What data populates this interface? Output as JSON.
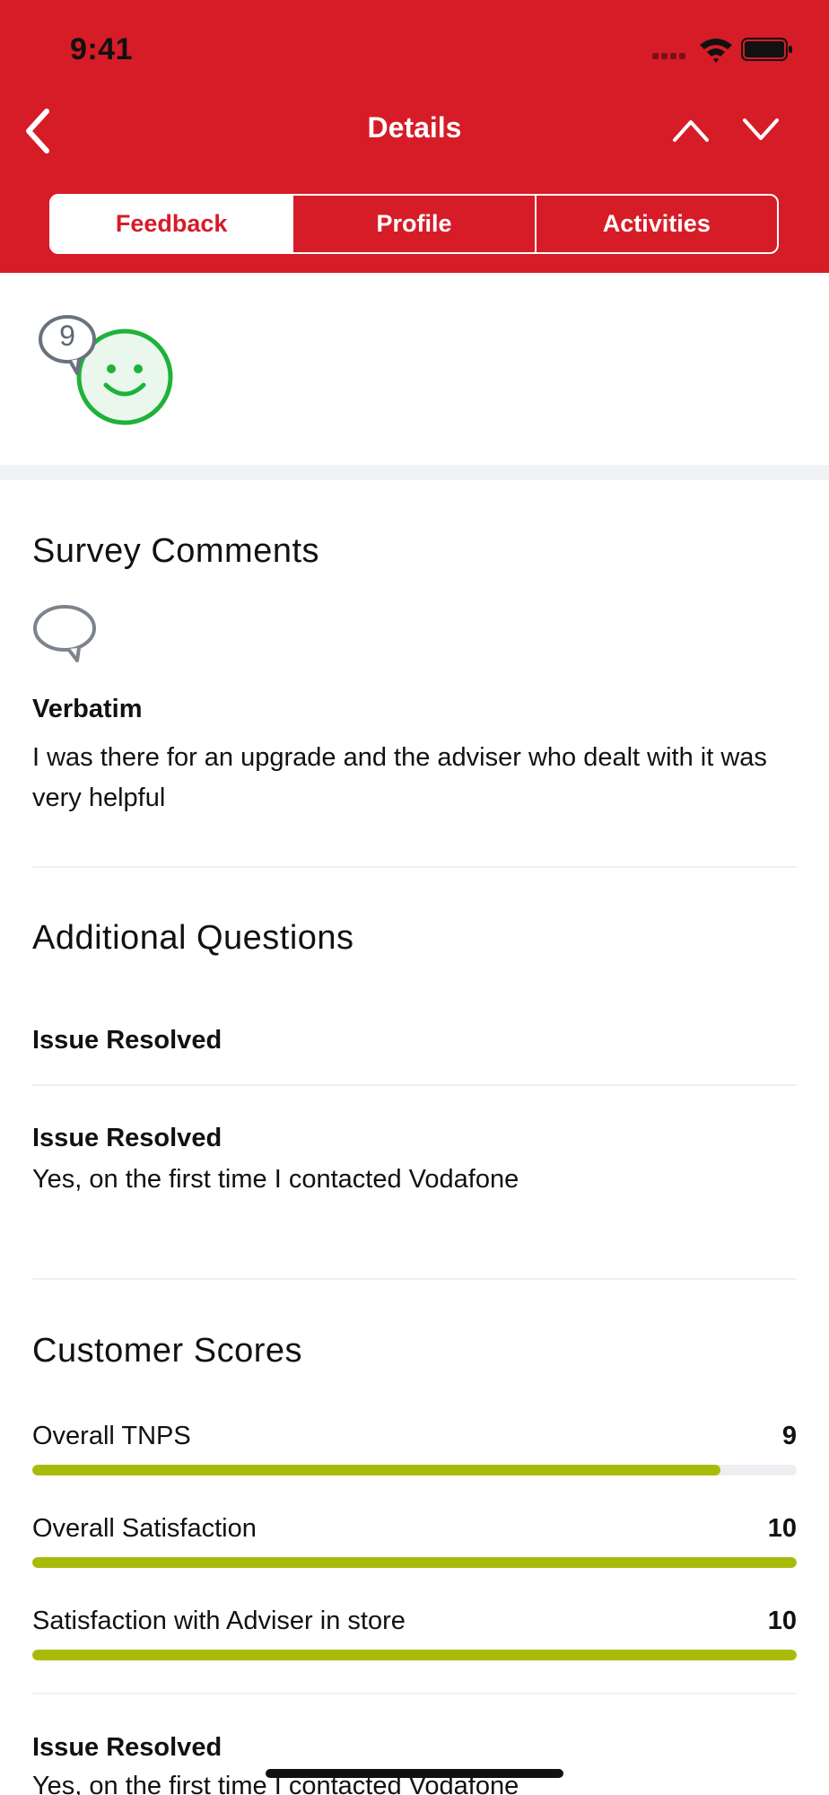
{
  "status_bar": {
    "time": "9:41"
  },
  "nav": {
    "title": "Details",
    "back_icon": "chevron-left-icon",
    "up_icon": "chevron-up-icon",
    "down_icon": "chevron-down-icon"
  },
  "tabs": [
    {
      "label": "Feedback",
      "active": true
    },
    {
      "label": "Profile",
      "active": false
    },
    {
      "label": "Activities",
      "active": false
    }
  ],
  "score_badge": {
    "value": "9",
    "face": "smiley-face-icon"
  },
  "survey": {
    "title": "Survey Comments",
    "icon": "speech-bubble-icon",
    "verbatim_label": "Verbatim",
    "verbatim_text": "I was there for an upgrade and the adviser who dealt with it was very helpful"
  },
  "additional": {
    "title": "Additional Questions",
    "items": [
      {
        "label": "Issue Resolved",
        "value": ""
      },
      {
        "label": "Issue Resolved",
        "value": "Yes, on the first time I contacted Vodafone"
      }
    ]
  },
  "customer_scores": {
    "title": "Customer Scores",
    "rows": [
      {
        "label": "Overall TNPS",
        "value": "9",
        "fraction": 0.9
      },
      {
        "label": "Overall Satisfaction",
        "value": "10",
        "fraction": 1.0
      },
      {
        "label": "Satisfaction with Adviser in store",
        "value": "10",
        "fraction": 1.0
      }
    ]
  },
  "footer_item": {
    "label": "Issue Resolved",
    "value": "Yes, on the first time I contacted Vodafone"
  },
  "colors": {
    "brand_red": "#d61c27",
    "score_bar": "#a9bb0a",
    "smiley_green": "#1fb23a"
  }
}
